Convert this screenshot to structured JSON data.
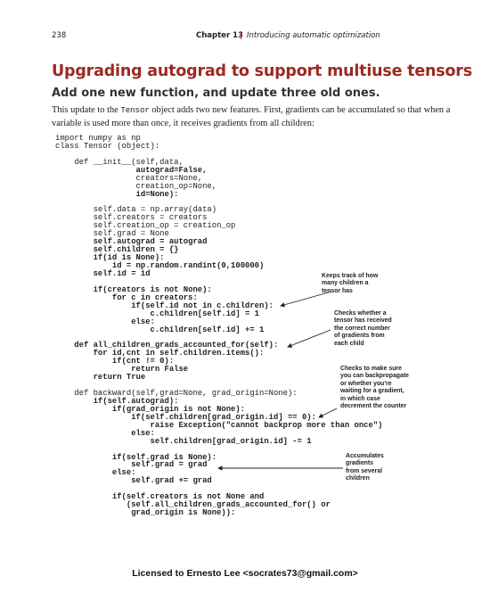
{
  "header": {
    "page_number": "238",
    "chapter": "Chapter 13",
    "separator": "|",
    "chapter_title": "Introducing automatic optimization"
  },
  "section_title": "Upgrading autograd to support multiuse tensors",
  "subtitle": "Add one new function, and update three old ones.",
  "intro": {
    "part1": "This update to the ",
    "code": "Tensor",
    "part2": " object adds two new features. First, gradients can be accumulated so that when a variable is used more than once, it receives gradients from all children:"
  },
  "code_lines": [
    {
      "text": "import numpy as np",
      "bold": false
    },
    {
      "text": "class Tensor (object):",
      "bold": false
    },
    {
      "text": "",
      "bold": false
    },
    {
      "text": "    def __init__(self,data,",
      "bold": false
    },
    {
      "text": "                 autograd=False,",
      "bold": true
    },
    {
      "text": "                 creators=None,",
      "bold": false
    },
    {
      "text": "                 creation_op=None,",
      "bold": false
    },
    {
      "text": "                 id=None):",
      "bold": true
    },
    {
      "text": "",
      "bold": false
    },
    {
      "text": "        self.data = np.array(data)",
      "bold": false
    },
    {
      "text": "        self.creators = creators",
      "bold": false
    },
    {
      "text": "        self.creation_op = creation_op",
      "bold": false
    },
    {
      "text": "        self.grad = None",
      "bold": false
    },
    {
      "text": "        self.autograd = autograd",
      "bold": true
    },
    {
      "text": "        self.children = {}",
      "bold": true
    },
    {
      "text": "        if(id is None):",
      "bold": true
    },
    {
      "text": "            id = np.random.randint(0,100000)",
      "bold": true
    },
    {
      "text": "        self.id = id",
      "bold": true
    },
    {
      "text": "",
      "bold": false
    },
    {
      "text": "        if(creators is not None):",
      "bold": true
    },
    {
      "text": "            for c in creators:",
      "bold": true
    },
    {
      "text": "                if(self.id not in c.children):",
      "bold": true
    },
    {
      "text": "                    c.children[self.id] = 1",
      "bold": true
    },
    {
      "text": "                else:",
      "bold": true
    },
    {
      "text": "                    c.children[self.id] += 1",
      "bold": true
    },
    {
      "text": "",
      "bold": false
    },
    {
      "text": "    def all_children_grads_accounted_for(self):",
      "bold": true
    },
    {
      "text": "        for id,cnt in self.children.items():",
      "bold": true
    },
    {
      "text": "            if(cnt != 0):",
      "bold": true
    },
    {
      "text": "                return False",
      "bold": true
    },
    {
      "text": "        return True",
      "bold": true
    },
    {
      "text": "",
      "bold": false
    },
    {
      "text": "    def backward(self,grad=None, grad_origin=None):",
      "bold": false
    },
    {
      "text": "        if(self.autograd):",
      "bold": true
    },
    {
      "text": "            if(grad_origin is not None):",
      "bold": true
    },
    {
      "text": "                if(self.children[grad_origin.id] == 0):",
      "bold": true
    },
    {
      "text": "                    raise Exception(\"cannot backprop more than once\")",
      "bold": true
    },
    {
      "text": "                else:",
      "bold": true
    },
    {
      "text": "                    self.children[grad_origin.id] -= 1",
      "bold": true
    },
    {
      "text": "",
      "bold": false
    },
    {
      "text": "            if(self.grad is None):",
      "bold": true
    },
    {
      "text": "                self.grad = grad",
      "bold": true
    },
    {
      "text": "            else:",
      "bold": true
    },
    {
      "text": "                self.grad += grad",
      "bold": true
    },
    {
      "text": "",
      "bold": false
    },
    {
      "text": "            if(self.creators is not None and",
      "bold": true
    },
    {
      "text": "               (self.all_children_grads_accounted_for() or",
      "bold": true
    },
    {
      "text": "                grad_origin is None)):",
      "bold": true
    }
  ],
  "annotations": [
    {
      "name": "annotation-children-count",
      "lines": [
        "Keeps track of how",
        "many children a",
        "tensor has"
      ]
    },
    {
      "name": "annotation-gradient-count",
      "lines": [
        "Checks whether a",
        "tensor has received",
        "the correct number",
        "of gradients from",
        "each child"
      ]
    },
    {
      "name": "annotation-backprop-check",
      "lines": [
        "Checks to make sure",
        "you can backpropagate",
        "or whether you're",
        "waiting for a gradient,",
        "in which case",
        "decrement the counter"
      ]
    },
    {
      "name": "annotation-accumulate",
      "lines": [
        "Accumulates",
        "gradients",
        "from several",
        "children"
      ]
    }
  ],
  "footer": "Licensed to Ernesto Lee <socrates73@gmail.com>"
}
